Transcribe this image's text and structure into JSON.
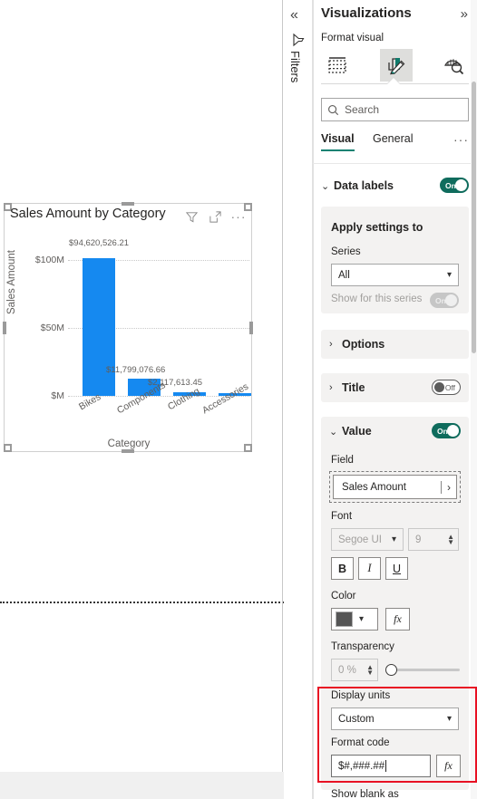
{
  "canvas": {
    "visual": {
      "title": "Sales Amount by Category",
      "header_icons": [
        "filter-icon",
        "focus-mode-icon",
        "more-options-icon"
      ]
    }
  },
  "chart_data": {
    "type": "bar",
    "title": "Sales Amount by Category",
    "xlabel": "Category",
    "ylabel": "Sales Amount",
    "categories": [
      "Bikes",
      "Components",
      "Clothing",
      "Accessories"
    ],
    "values": [
      94620526.21,
      11799076.66,
      2117613.45,
      1272057.0
    ],
    "data_labels": [
      "$94,620,526.21",
      "$11,799,076.66",
      "$2,117,613.45",
      ""
    ],
    "ytick_labels": [
      "$100M",
      "$50M",
      "$M"
    ],
    "ytick_values": [
      100000000,
      50000000,
      0
    ],
    "ylim": [
      0,
      105000000
    ],
    "grid": true,
    "legend": "none",
    "series_color": "#1589f0"
  },
  "filters_rail": {
    "collapse_icon": "chevron-double-left-icon",
    "filter_icon": "filter-funnel-icon",
    "label": "Filters"
  },
  "viz_pane": {
    "title": "Visualizations",
    "expand_icon": "chevron-double-right-icon",
    "format_visual_label": "Format visual",
    "icon_buttons": [
      {
        "name": "build-visual-icon",
        "selected": false
      },
      {
        "name": "format-visual-icon",
        "selected": true
      },
      {
        "name": "analytics-icon",
        "selected": false
      }
    ],
    "search": {
      "placeholder": "Search",
      "icon": "search-icon"
    },
    "tabs": [
      {
        "label": "Visual",
        "active": true
      },
      {
        "label": "General",
        "active": false
      }
    ],
    "tabs_more": "···",
    "sections": {
      "data_labels": {
        "label": "Data labels",
        "chevron": "⌄",
        "toggle": "On",
        "state": "on"
      },
      "apply_settings": {
        "title": "Apply settings to",
        "series_label": "Series",
        "series_value": "All",
        "show_for_this_series_label": "Show for this series",
        "show_for_this_series_toggle": "On",
        "show_for_this_series_state": "disabled"
      },
      "options": {
        "label": "Options",
        "chevron": "›"
      },
      "title": {
        "label": "Title",
        "chevron": "›",
        "toggle": "Off",
        "state": "off"
      },
      "value": {
        "label": "Value",
        "chevron": "⌄",
        "toggle": "On",
        "state": "on",
        "field_label": "Field",
        "field_value": "Sales Amount",
        "field_expand": "›",
        "font_label": "Font",
        "font_family": "Segoe UI",
        "font_size": "9",
        "bold": "B",
        "italic": "I",
        "underline": "U",
        "color_label": "Color",
        "color_value": "#555555",
        "fx_label": "fx",
        "transparency_label": "Transparency",
        "transparency_value": "0 %",
        "display_units_label": "Display units",
        "display_units_value": "Custom",
        "format_code_label": "Format code",
        "format_code_value": "$#,###.##",
        "format_code_fx": "fx",
        "show_blank_as_label": "Show blank as"
      }
    }
  }
}
